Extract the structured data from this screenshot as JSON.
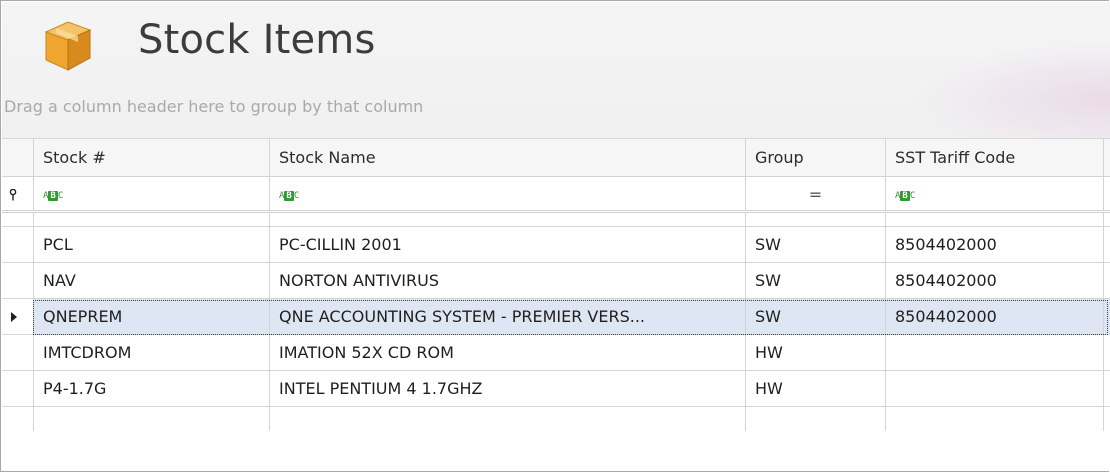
{
  "header": {
    "title": "Stock Items",
    "group_hint": "Drag a column header here to group by that column",
    "icon": "box-icon"
  },
  "columns": [
    "Stock #",
    "Stock Name",
    "Group",
    "SST Tariff Code"
  ],
  "filter_row": {
    "text_filter_icon": "abc-filter-icon",
    "abc": [
      "A",
      "B",
      "C"
    ],
    "equals_symbol": "="
  },
  "rows": [
    {
      "stock_no": "PCL",
      "stock_name": "PC-CILLIN 2001",
      "group": "SW",
      "sst_tariff": "8504402000"
    },
    {
      "stock_no": "NAV",
      "stock_name": "NORTON ANTIVIRUS",
      "group": "SW",
      "sst_tariff": "8504402000"
    },
    {
      "stock_no": "QNEPREM",
      "stock_name": "QNE  ACCOUNTING SYSTEM - PREMIER VERS...",
      "group": "SW",
      "sst_tariff": "8504402000"
    },
    {
      "stock_no": "IMTCDROM",
      "stock_name": "IMATION 52X CD ROM",
      "group": "HW",
      "sst_tariff": ""
    },
    {
      "stock_no": "P4-1.7G",
      "stock_name": "INTEL PENTIUM 4 1.7GHZ",
      "group": "HW",
      "sst_tariff": ""
    }
  ],
  "selected_row": 2,
  "colors": {
    "selected_row": "#dfe6f3",
    "filter_icon_green": "#2f9a2f",
    "box_icon": "#e7a23a"
  }
}
